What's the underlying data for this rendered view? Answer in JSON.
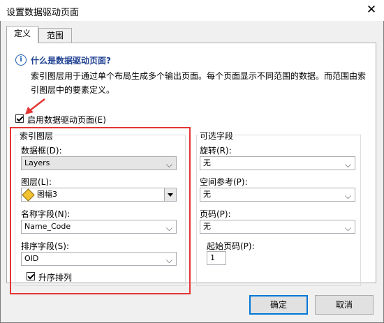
{
  "window": {
    "title": "设置数据驱动页面"
  },
  "tabs": [
    {
      "label": "定义"
    },
    {
      "label": "范围"
    }
  ],
  "info": {
    "title": "什么是数据驱动页面?",
    "description": "索引图层用于通过单个布局生成多个输出页面。每个页面显示不同范围的数据。而范围由索引图层中的要素定义。"
  },
  "enable_checkbox": {
    "label": "启用数据驱动页面(E)",
    "checked": true
  },
  "index_layer": {
    "group_label": "索引图层",
    "data_frame": {
      "label": "数据框(D):",
      "value": "Layers"
    },
    "layer": {
      "label": "图层(L):",
      "value": "图幅3"
    },
    "name_field": {
      "label": "名称字段(N):",
      "value": "Name_Code"
    },
    "sort_field": {
      "label": "排序字段(S):",
      "value": "OID"
    },
    "ascending": {
      "label": "升序排列",
      "checked": true
    }
  },
  "optional_fields": {
    "group_label": "可选字段",
    "rotation": {
      "label": "旋转(R):",
      "value": "无"
    },
    "spatial_ref": {
      "label": "空间参考(P):",
      "value": "无"
    },
    "page_number": {
      "label": "页码(P):",
      "value": "无"
    },
    "start_page": {
      "label": "起始页码(P):",
      "value": "1"
    }
  },
  "buttons": {
    "ok": "确定",
    "cancel": "取消"
  },
  "colors": {
    "annotation_red": "#e53535",
    "info_blue": "#1e3f91",
    "default_button_border": "#0078d7"
  }
}
